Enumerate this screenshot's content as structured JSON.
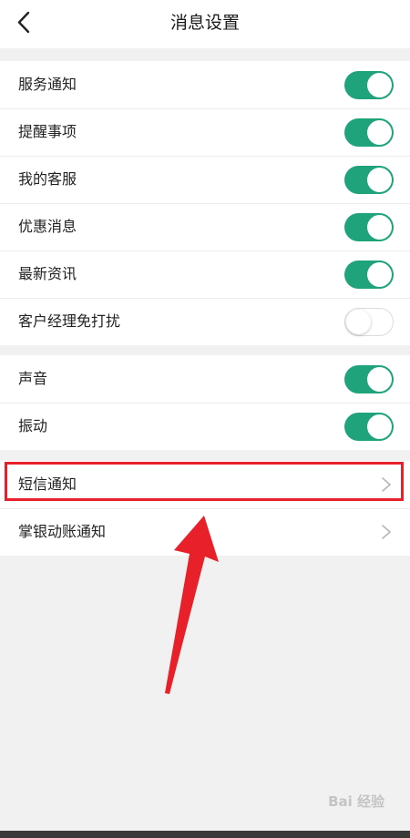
{
  "header": {
    "title": "消息设置",
    "back_icon": "chevron-left-icon"
  },
  "groups": [
    {
      "items": [
        {
          "label": "服务通知",
          "toggle": "on"
        },
        {
          "label": "提醒事项",
          "toggle": "on"
        },
        {
          "label": "我的客服",
          "toggle": "on"
        },
        {
          "label": "优惠消息",
          "toggle": "on"
        },
        {
          "label": "最新资讯",
          "toggle": "on"
        },
        {
          "label": "客户经理免打扰",
          "toggle": "off"
        }
      ]
    },
    {
      "items": [
        {
          "label": "声音",
          "toggle": "on"
        },
        {
          "label": "振动",
          "toggle": "on"
        }
      ]
    },
    {
      "items": [
        {
          "label": "短信通知",
          "trailing_icon": "chevron-right-icon",
          "highlighted": true
        },
        {
          "label": "掌银动账通知",
          "trailing_icon": "chevron-right-icon"
        }
      ]
    }
  ],
  "annotation": {
    "highlight_color": "#e8202a",
    "arrow_color": "#e8202a"
  },
  "colors": {
    "toggle_on": "#1fa37a",
    "background": "#f1f1f1"
  },
  "watermark": "Bai 经验"
}
